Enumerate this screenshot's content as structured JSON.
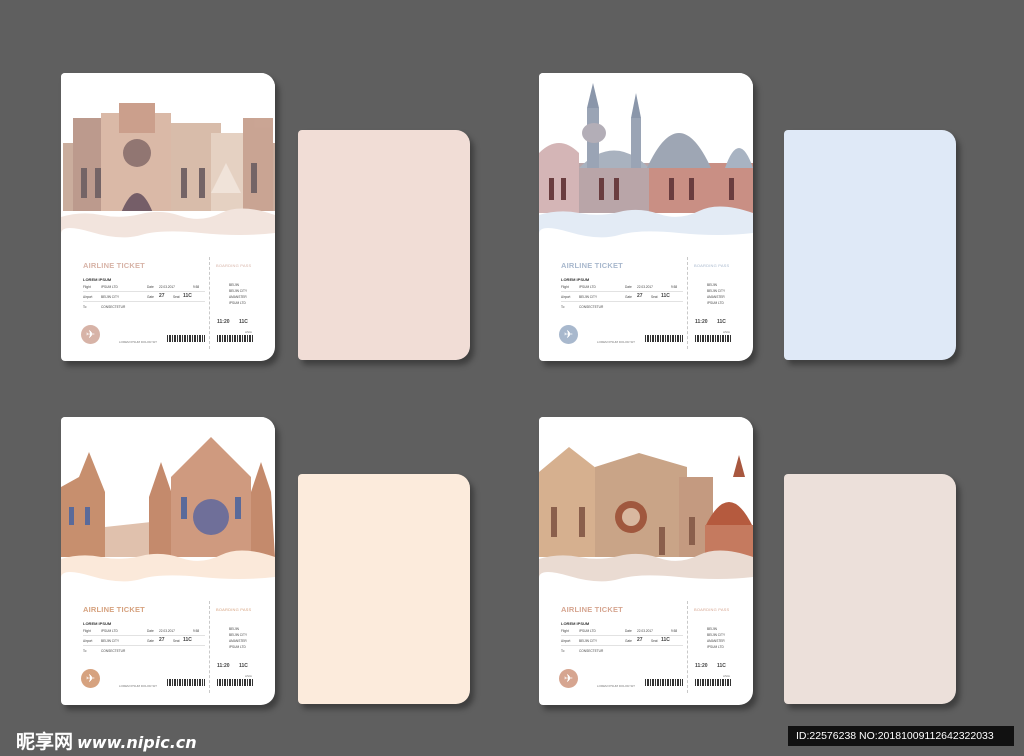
{
  "ticket": {
    "title": "AIRLINE TICKET",
    "boarding": "BOARDING PASS",
    "name": "LOREM IPSUM",
    "from_label": "Flight",
    "from_value": "IPSUM LTD",
    "date_label": "Date",
    "date_value": "22.03.2017",
    "code_value": "9:58",
    "via_label": "Airport",
    "via_value": "BEIJIN CITY",
    "gate_label": "Gate",
    "gate_value": "27",
    "seat_label": "Seat",
    "seat_value": "11C",
    "to_label": "To",
    "to_value": "CONSECTETUR",
    "right_lines": [
      "BEIJIN",
      "BEIJIN CITY",
      "AMANSTER",
      "IPSUM LTD"
    ],
    "time_value": "11:20",
    "seat2_value": "11C",
    "footer": "LOREM IPSUM DOLOR SIT",
    "footer_right": "ASIA"
  },
  "cards": [
    {
      "accent": "#d7b3a7",
      "back": "#f1ddd6"
    },
    {
      "accent": "#a8b8cd",
      "back": "#dfe9f7"
    },
    {
      "accent": "#d6a27f",
      "back": "#fcebdc"
    },
    {
      "accent": "#d6a590",
      "back": "#ece0da"
    }
  ],
  "watermark": {
    "logo": "昵享网",
    "url": "www.nipic.cn"
  },
  "id_bar": "ID:22576238 NO:20181009112642322033",
  "icons": {
    "plane": "airplane-icon"
  }
}
